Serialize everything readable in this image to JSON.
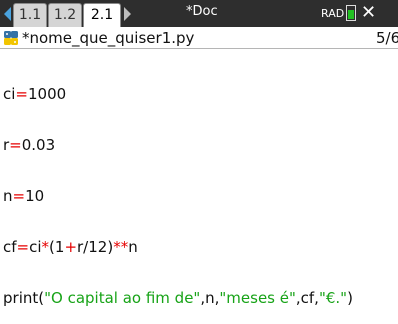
{
  "tabs": [
    {
      "label": "1.1",
      "active": false
    },
    {
      "label": "1.2",
      "active": false
    },
    {
      "label": "2.1",
      "active": true
    }
  ],
  "document_title": "*Doc",
  "mode": "RAD",
  "file": {
    "name": "*nome_que_quiser1.py",
    "page": "5/6"
  },
  "code": {
    "l1": [
      "ci",
      "=",
      "1000"
    ],
    "l2": [
      "r",
      "=",
      "0.03"
    ],
    "l3": [
      "n",
      "=",
      "10"
    ],
    "l4": [
      "cf",
      "=",
      "ci",
      "*",
      "(1",
      "+",
      "r/12)",
      "**",
      "n"
    ],
    "l5": [
      "print(",
      "\"O capital ao fim de\"",
      ",n,",
      "\"meses é\"",
      ",cf,",
      "\"€.\"",
      ")"
    ]
  },
  "colors": {
    "operator": "#e60000",
    "string": "#17a317",
    "topbar": "#2e2e2e",
    "nav_arrow": "#4aa3df",
    "battery": "#22c022"
  }
}
